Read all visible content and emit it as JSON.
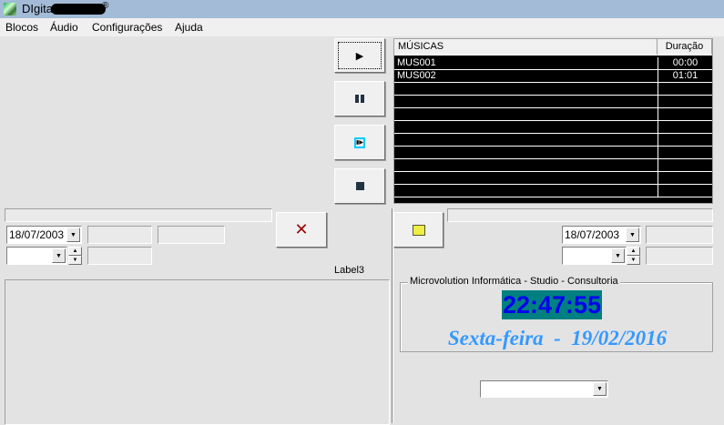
{
  "window": {
    "title": "DIgital"
  },
  "menu": [
    "Blocos",
    "Áudio",
    "Configurações",
    "Ajuda"
  ],
  "playlist": {
    "headers": [
      "MÚSICAS",
      "Duração"
    ],
    "rows": [
      [
        "MUS001",
        "00:00"
      ],
      [
        "MUS002",
        "01:01"
      ],
      [
        "",
        ""
      ],
      [
        "",
        ""
      ],
      [
        "",
        ""
      ],
      [
        "",
        ""
      ],
      [
        "",
        ""
      ],
      [
        "",
        ""
      ],
      [
        "",
        ""
      ],
      [
        "",
        ""
      ],
      [
        "",
        ""
      ]
    ]
  },
  "left": {
    "date": "18/07/2003"
  },
  "right": {
    "date": "18/07/2003"
  },
  "label3": "Label3",
  "info": {
    "group_title": "Microvolution Informática - Studio - Consultoria",
    "clock": "22:47:55",
    "date_text": "Sexta-feira  -  19/02/2016"
  },
  "colors": {
    "clock_bg": "#008080",
    "clock_fg": "#0000ee",
    "date_fg": "#3399ff"
  }
}
